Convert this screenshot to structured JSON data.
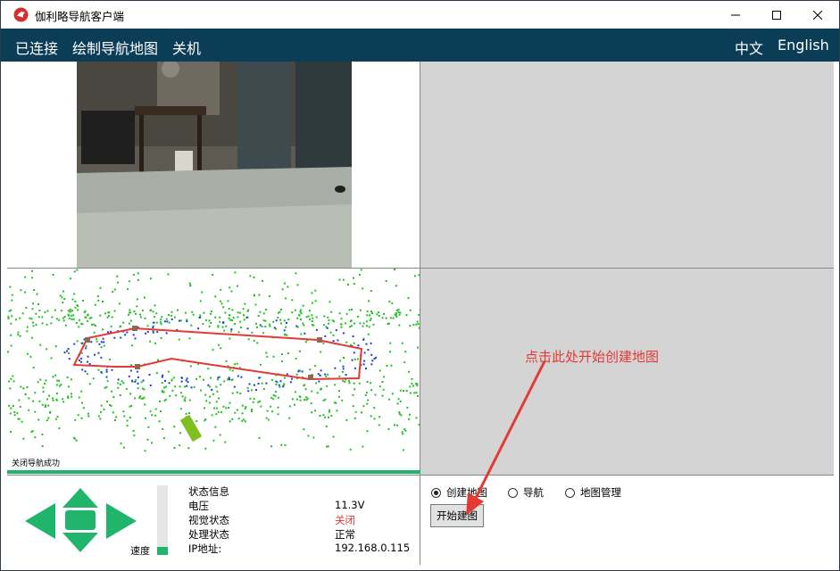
{
  "window": {
    "title": "伽利略导航客户端"
  },
  "menu": {
    "connected": "已连接",
    "draw_map": "绘制导航地图",
    "shutdown": "关机",
    "lang_zh": "中文",
    "lang_en": "English"
  },
  "map": {
    "status_text": "关闭导航成功"
  },
  "hint": "点击此处开始创建地图",
  "speed": {
    "label": "速度",
    "level": 0.12
  },
  "status": {
    "heading": "状态信息",
    "rows": [
      {
        "label": "电压",
        "value": "11.3V",
        "color": "#000000"
      },
      {
        "label": "视觉状态",
        "value": "关闭",
        "color": "#e53935"
      },
      {
        "label": "处理状态",
        "value": "正常",
        "color": "#000000"
      },
      {
        "label": "IP地址:",
        "value": "192.168.0.115",
        "color": "#000000"
      }
    ]
  },
  "modes": {
    "options": [
      "创建地图",
      "导航",
      "地图管理"
    ],
    "selected": "创建地图"
  },
  "start_button": "开始建图",
  "colors": {
    "menubar": "#0c3d57",
    "accent_green": "#20b56b",
    "path_red": "#e53935"
  }
}
